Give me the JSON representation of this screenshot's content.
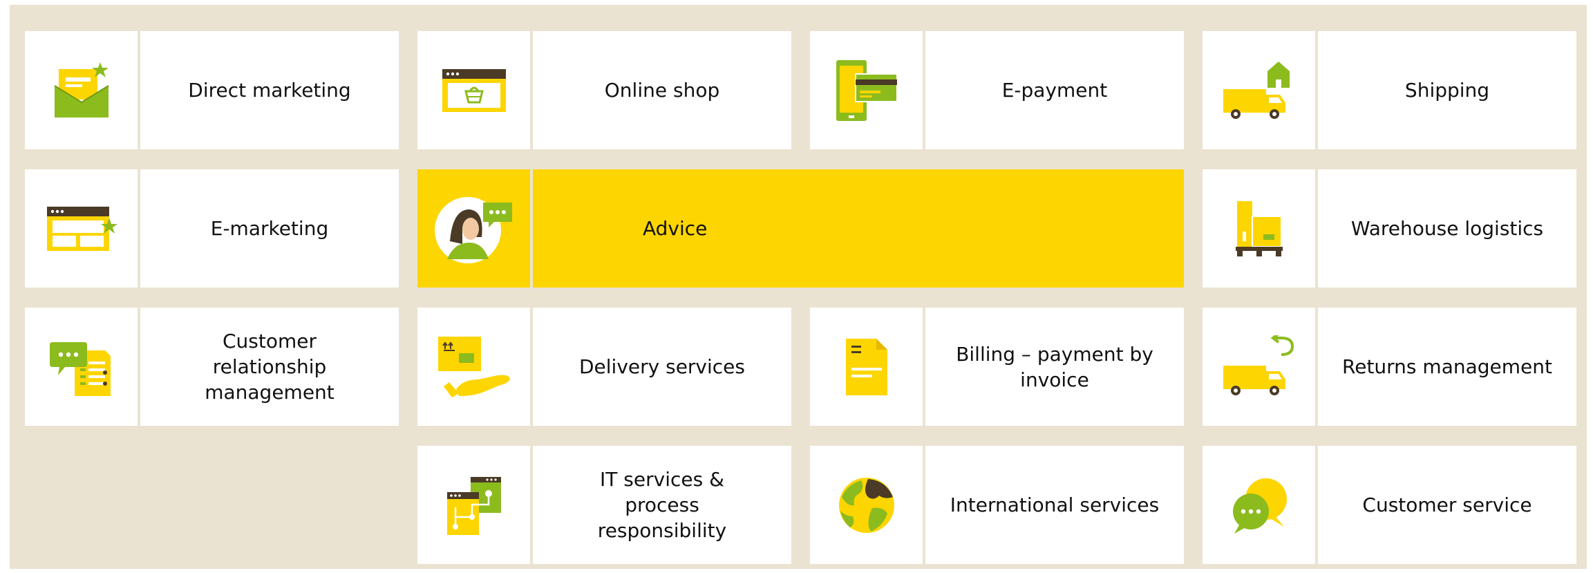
{
  "colors": {
    "background": "#ebe3d1",
    "tile": "#ffffff",
    "accent_yellow": "#fdd501",
    "accent_green": "#8cbb1e",
    "dark_brown": "#4a3a26"
  },
  "services": [
    {
      "label": "Direct marketing",
      "icon": "mail-envelope-icon"
    },
    {
      "label": "Online shop",
      "icon": "shop-basket-icon"
    },
    {
      "label": "E-payment",
      "icon": "payment-card-icon"
    },
    {
      "label": "Shipping",
      "icon": "delivery-truck-icon"
    },
    {
      "label": "E-marketing",
      "icon": "browser-window-icon"
    },
    {
      "label": "Advice",
      "icon": "advisor-person-icon"
    },
    {
      "label": "Warehouse logistics",
      "icon": "warehouse-boxes-icon"
    },
    {
      "label": "Customer relationship management",
      "icon": "crm-document-icon"
    },
    {
      "label": "Delivery services",
      "icon": "parcel-hand-icon"
    },
    {
      "label": "Billing – payment by invoice",
      "icon": "invoice-icon"
    },
    {
      "label": "Returns management",
      "icon": "returns-truck-icon"
    },
    {
      "label": "IT services & process responsibility",
      "icon": "process-flow-icon"
    },
    {
      "label": "International services",
      "icon": "globe-icon"
    },
    {
      "label": "Customer service",
      "icon": "speech-bubbles-icon"
    }
  ]
}
